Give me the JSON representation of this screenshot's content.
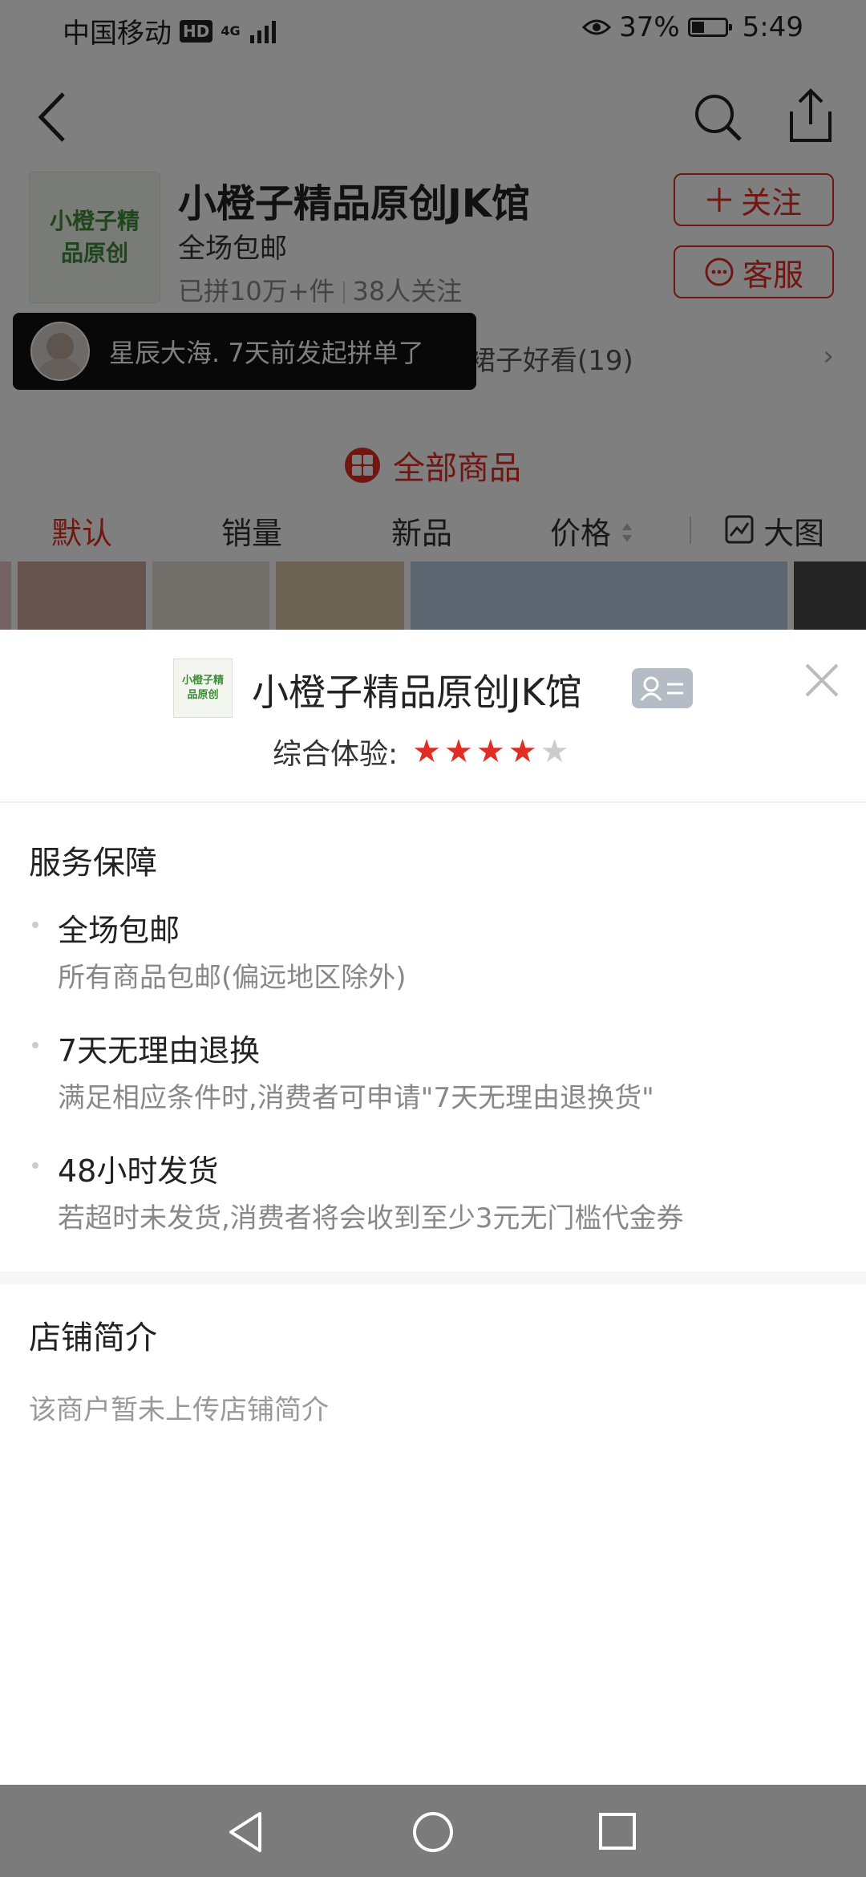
{
  "status": {
    "carrier": "中国移动",
    "hd": "HD",
    "network": "4G",
    "battery": "37%",
    "time": "5:49"
  },
  "shop": {
    "logo_line1": "小橙子精",
    "logo_line2": "品原创",
    "name": "小橙子精品原创JK馆",
    "tag": "全场包邮",
    "sold": "已拼10万+件",
    "followers": "38人关注",
    "follow_label": "关注",
    "service_label": "客服",
    "review_tag": "裙子好看(19)"
  },
  "toast": {
    "text": "星辰大海. 7天前发起拼单了"
  },
  "goods": {
    "all_label": "全部商品",
    "sorts": [
      "默认",
      "销量",
      "新品",
      "价格"
    ],
    "bigpic_label": "大图"
  },
  "sheet": {
    "logo_line1": "小橙子精",
    "logo_line2": "品原创",
    "title": "小橙子精品原创JK馆",
    "rating_label": "综合体验:",
    "rating": 4,
    "rating_max": 5,
    "service_heading": "服务保障",
    "services": [
      {
        "title": "全场包邮",
        "desc": "所有商品包邮(偏远地区除外)"
      },
      {
        "title": "7天无理由退换",
        "desc": "满足相应条件时,消费者可申请\"7天无理由退换货\""
      },
      {
        "title": "48小时发货",
        "desc": "若超时未发货,消费者将会收到至少3元无门槛代金券"
      }
    ],
    "intro_heading": "店铺简介",
    "intro_text": "该商户暂未上传店铺简介"
  },
  "colors": {
    "accent": "#e02e24",
    "star_off": "#cccccc"
  },
  "icons": [
    "back-icon",
    "search-icon",
    "share-icon",
    "plus-icon",
    "chat-icon",
    "chevron-right-icon",
    "grid-icon",
    "sort-arrows-icon",
    "bigpic-icon",
    "id-card-icon",
    "close-icon",
    "nav-back-icon",
    "nav-home-icon",
    "nav-recent-icon"
  ]
}
